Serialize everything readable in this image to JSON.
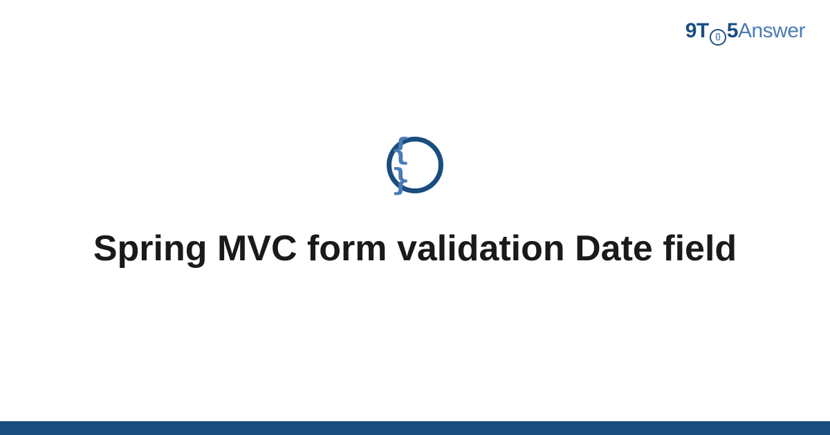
{
  "brand": {
    "part1": "9T",
    "circle_inner": "{}",
    "part2": "5",
    "part3": "Answer"
  },
  "icon": {
    "braces": "{ }"
  },
  "title": "Spring MVC form validation Date field",
  "colors": {
    "primary_dark": "#1a4d80",
    "primary_light": "#4a7bb5",
    "text": "#1a1a1a",
    "background": "#ffffff"
  }
}
